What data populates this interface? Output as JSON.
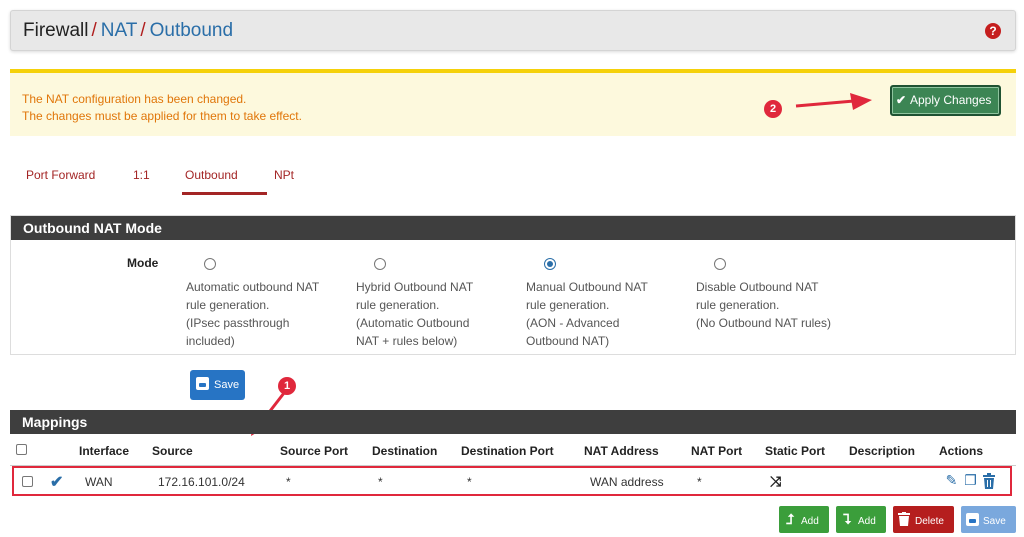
{
  "breadcrumb": {
    "root": "Firewall",
    "sep": "/",
    "nat": "NAT",
    "page": "Outbound"
  },
  "help_icon": "question-circle-icon",
  "alert": {
    "line1": "The NAT configuration has been changed.",
    "line2": "The changes must be applied for them to take effect.",
    "apply_label": "Apply Changes",
    "marker": "2"
  },
  "tabs": [
    {
      "label": "Port Forward"
    },
    {
      "label": "1:1"
    },
    {
      "label": "Outbound",
      "active": true
    },
    {
      "label": "NPt"
    }
  ],
  "mode_panel": {
    "title": "Outbound NAT Mode",
    "label": "Mode",
    "options": [
      {
        "lines": [
          "Automatic outbound NAT",
          "rule generation.",
          "(IPsec passthrough",
          "included)"
        ],
        "selected": false
      },
      {
        "lines": [
          "Hybrid Outbound NAT",
          "rule generation.",
          "(Automatic Outbound",
          "NAT + rules below)"
        ],
        "selected": false
      },
      {
        "lines": [
          "Manual Outbound NAT",
          "rule generation.",
          "(AON - Advanced",
          "Outbound NAT)"
        ],
        "selected": true
      },
      {
        "lines": [
          "Disable Outbound NAT",
          "rule generation.",
          "(No Outbound NAT rules)",
          ""
        ],
        "selected": false
      }
    ],
    "save_label": "Save",
    "marker": "1"
  },
  "mappings": {
    "title": "Mappings",
    "headers": [
      "Interface",
      "Source",
      "Source Port",
      "Destination",
      "Destination Port",
      "NAT Address",
      "NAT Port",
      "Static Port",
      "Description",
      "Actions"
    ],
    "rows": [
      {
        "interface": "WAN",
        "source": "172.16.101.0/24",
        "source_port": "*",
        "destination": "*",
        "destination_port": "*",
        "nat_address": "WAN address",
        "nat_port": "*",
        "static_port_icon": "shuffle-icon",
        "description": ""
      }
    ]
  },
  "bottom_buttons": {
    "add_top": "Add",
    "add_bottom": "Add",
    "delete": "Delete",
    "save": "Save"
  },
  "colors": {
    "accent_red": "#a32525",
    "link_blue": "#2a6ea8",
    "panel_header": "#3e3e3e",
    "alert_bg": "#fdf9dd",
    "alert_text": "#e0760a",
    "marker": "#e0283c"
  }
}
